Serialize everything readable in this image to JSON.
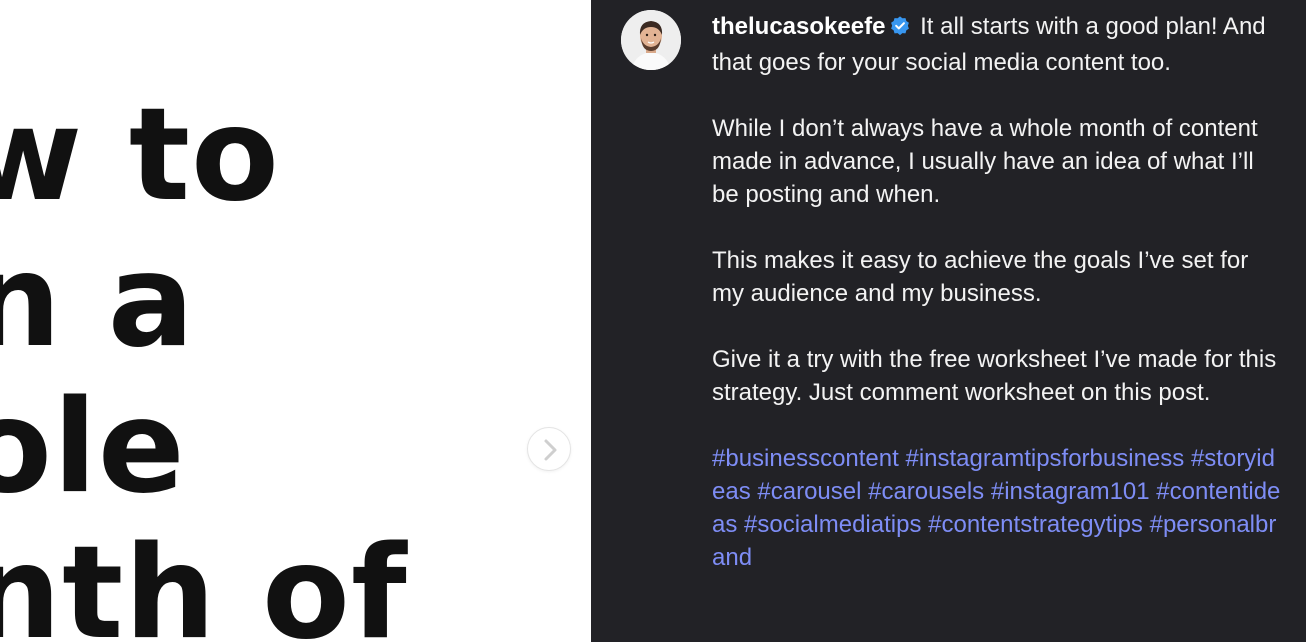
{
  "slide": {
    "lines": [
      "w to",
      "n a",
      "ole",
      "nth of"
    ]
  },
  "carousel": {
    "next_icon": "chevron-right-icon"
  },
  "post": {
    "username": "thelucasokeefe",
    "verified_icon": "verified-badge-icon",
    "paragraph1_rest": "It all starts with a good plan! And that goes for your social media content too.",
    "paragraph2": "While I don’t always have a whole month of content made in advance, I usually have an idea of what I’ll be posting and when.",
    "paragraph3": "This makes it easy to achieve the goals I’ve set for my audience and my business.",
    "paragraph4": "Give it a try with the free worksheet I’ve made for this strategy. Just comment worksheet on this post.",
    "hashtags": [
      "#businesscontent",
      "#instagramtipsforbusiness",
      "#storyideas",
      "#carousel",
      "#carousels",
      "#instagram101",
      "#contentideas",
      "#socialmediatips",
      "#contentstrategytips",
      "#personalbrand"
    ]
  },
  "colors": {
    "panel_bg": "#222226",
    "hashtag": "#7e8df5",
    "verified": "#3897f0"
  }
}
